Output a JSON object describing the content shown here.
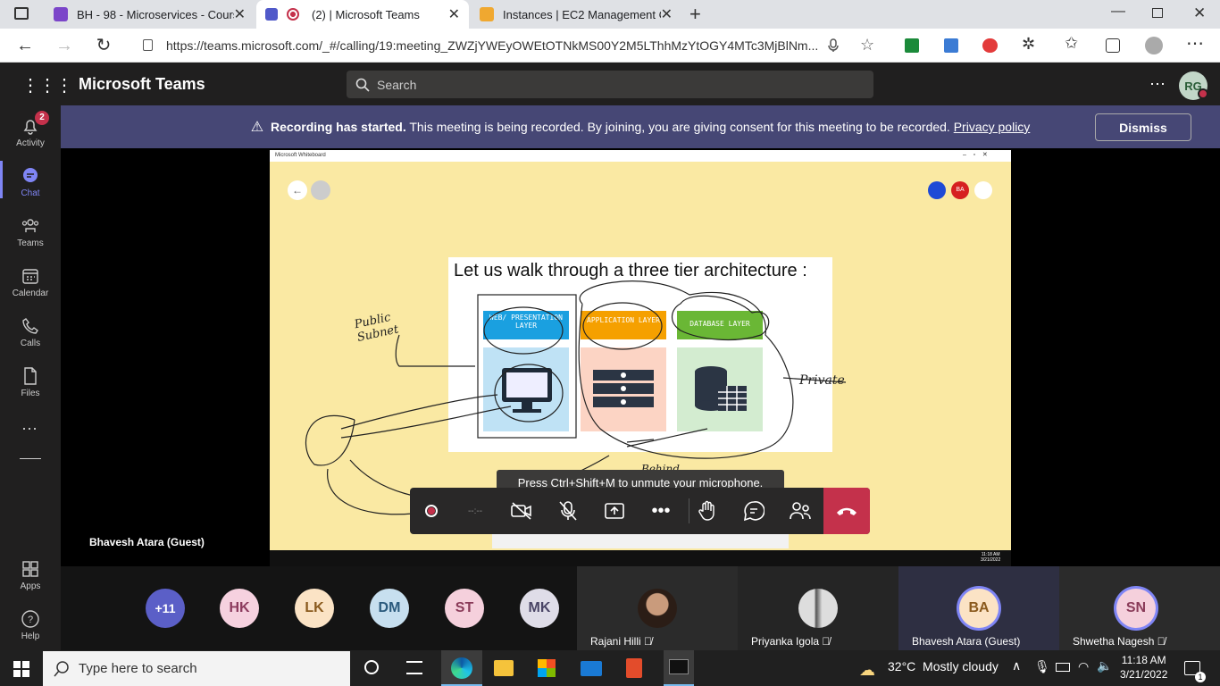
{
  "browser": {
    "tabs": [
      {
        "title": "BH - 98 - Microservices - Course",
        "active": false
      },
      {
        "title": "(2) | Microsoft Teams",
        "active": true
      },
      {
        "title": "Instances | EC2 Management Co",
        "active": false
      }
    ],
    "url": "https://teams.microsoft.com/_#/calling/19:meeting_ZWZjYWEyOWEtOTNkMS00Y2M5LThhMzYtOGY4MTc3MjBlNm..."
  },
  "teams": {
    "app_title": "Microsoft Teams",
    "search_placeholder": "Search",
    "user_initials": "RG",
    "rail": [
      {
        "label": "Activity",
        "badge": "2"
      },
      {
        "label": "Chat"
      },
      {
        "label": "Teams"
      },
      {
        "label": "Calendar"
      },
      {
        "label": "Calls"
      },
      {
        "label": "Files"
      },
      {
        "label": "Apps"
      },
      {
        "label": "Help"
      }
    ]
  },
  "banner": {
    "bold": "Recording has started.",
    "text": " This meeting is being recorded. By joining, you are giving consent for this meeting to be recorded. ",
    "link": "Privacy policy",
    "dismiss": "Dismiss"
  },
  "whiteboard": {
    "window_title": "Microsoft Whiteboard",
    "slide_title": "Let us walk through a three tier architecture :",
    "layers": [
      "WEB/ PRESENTATION LAYER",
      "APPLICATION LAYER",
      "DATABASE LAYER"
    ],
    "annotations": [
      "Public Subnet",
      "Private",
      "Behind"
    ],
    "mini_clock": [
      "11:18 AM",
      "3/21/2022"
    ]
  },
  "stage_participant": "Bhavesh Atara (Guest)",
  "tooltip": "Press Ctrl+Shift+M to unmute your microphone.",
  "controls": {
    "timer": "--:--"
  },
  "participants": {
    "overflow": "+11",
    "avatars": [
      "HK",
      "LK",
      "DM",
      "ST",
      "MK"
    ],
    "tiles": [
      {
        "name": "Rajani Hilli"
      },
      {
        "name": "Priyanka Igola"
      },
      {
        "name": "Bhavesh Atara (Guest)",
        "initials": "BA"
      },
      {
        "name": "Shwetha Nagesh",
        "initials": "SN"
      }
    ]
  },
  "taskbar": {
    "search_placeholder": "Type here to search",
    "weather": "32°C  Mostly cloudy",
    "time": "11:18 AM",
    "date": "3/21/2022",
    "notifications": "1"
  }
}
